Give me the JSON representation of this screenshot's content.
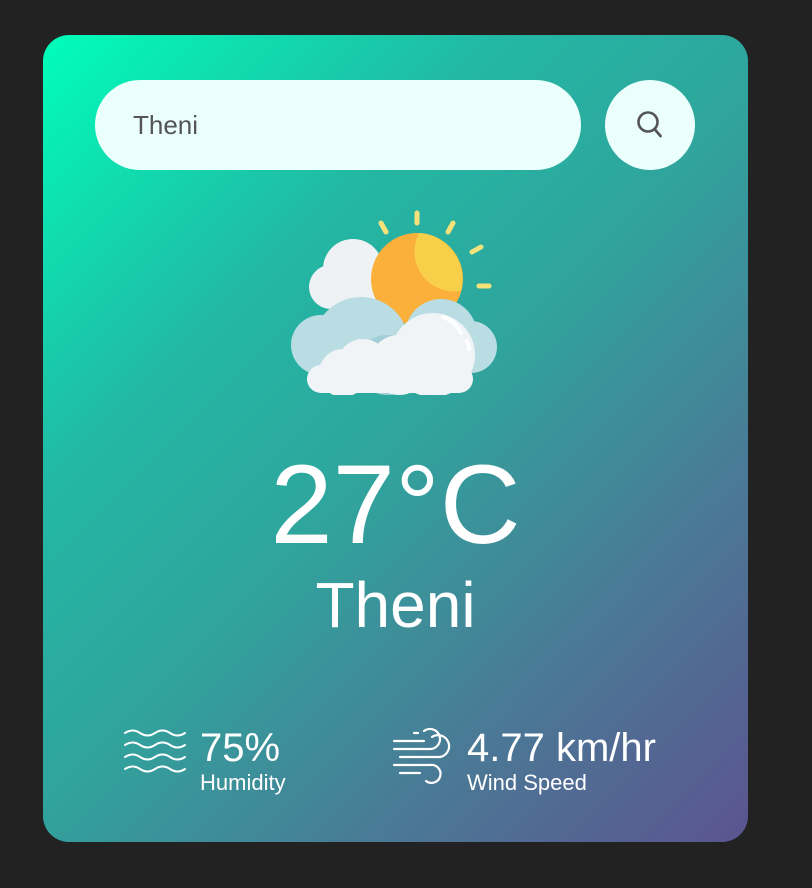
{
  "search": {
    "value": "Theni",
    "button_icon": "search-icon"
  },
  "weather": {
    "icon": "partly-cloudy-sun-icon",
    "temperature": "27°C",
    "city": "Theni"
  },
  "details": {
    "humidity": {
      "icon": "humidity-waves-icon",
      "value": "75%",
      "label": "Humidity"
    },
    "wind": {
      "icon": "wind-icon",
      "value": "4.77 km/hr",
      "label": "Wind Speed"
    }
  },
  "colors": {
    "background": "#222222",
    "card_gradient_start": "#00feba",
    "card_gradient_end": "#5b548f",
    "input_background": "#ebfffc",
    "text": "#ffffff"
  }
}
